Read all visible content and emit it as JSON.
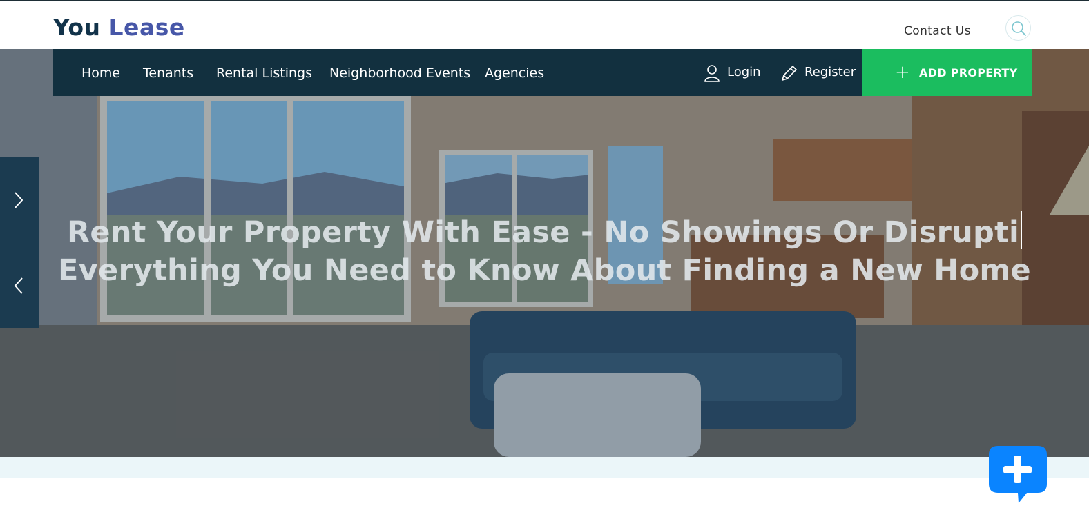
{
  "header": {
    "logo_part1": "You",
    "logo_part2": "Lease",
    "contact_label": "Contact Us",
    "search_icon": "search-icon"
  },
  "nav": {
    "items": [
      "Home",
      "Tenants",
      "Rental Listings",
      "Neighborhood Events",
      "Agencies"
    ],
    "login_label": "Login",
    "register_label": "Register",
    "add_property_label": "ADD PROPERTY"
  },
  "hero": {
    "headline_1": "Rent Your Property With Ease - No Showings Or Disrupti",
    "headline_2": "Everything You Need to Know About Finding a New Home",
    "next_icon": "chevron-right-icon",
    "prev_icon": "chevron-left-icon"
  },
  "colors": {
    "brand_dark": "#12334a",
    "brand_accent": "#4757a8",
    "nav_bg": "#12303f",
    "add_property_bg": "#1bbd5f",
    "chat_bg": "#0a84ff"
  },
  "chat": {
    "icon": "plus-chat-icon"
  }
}
